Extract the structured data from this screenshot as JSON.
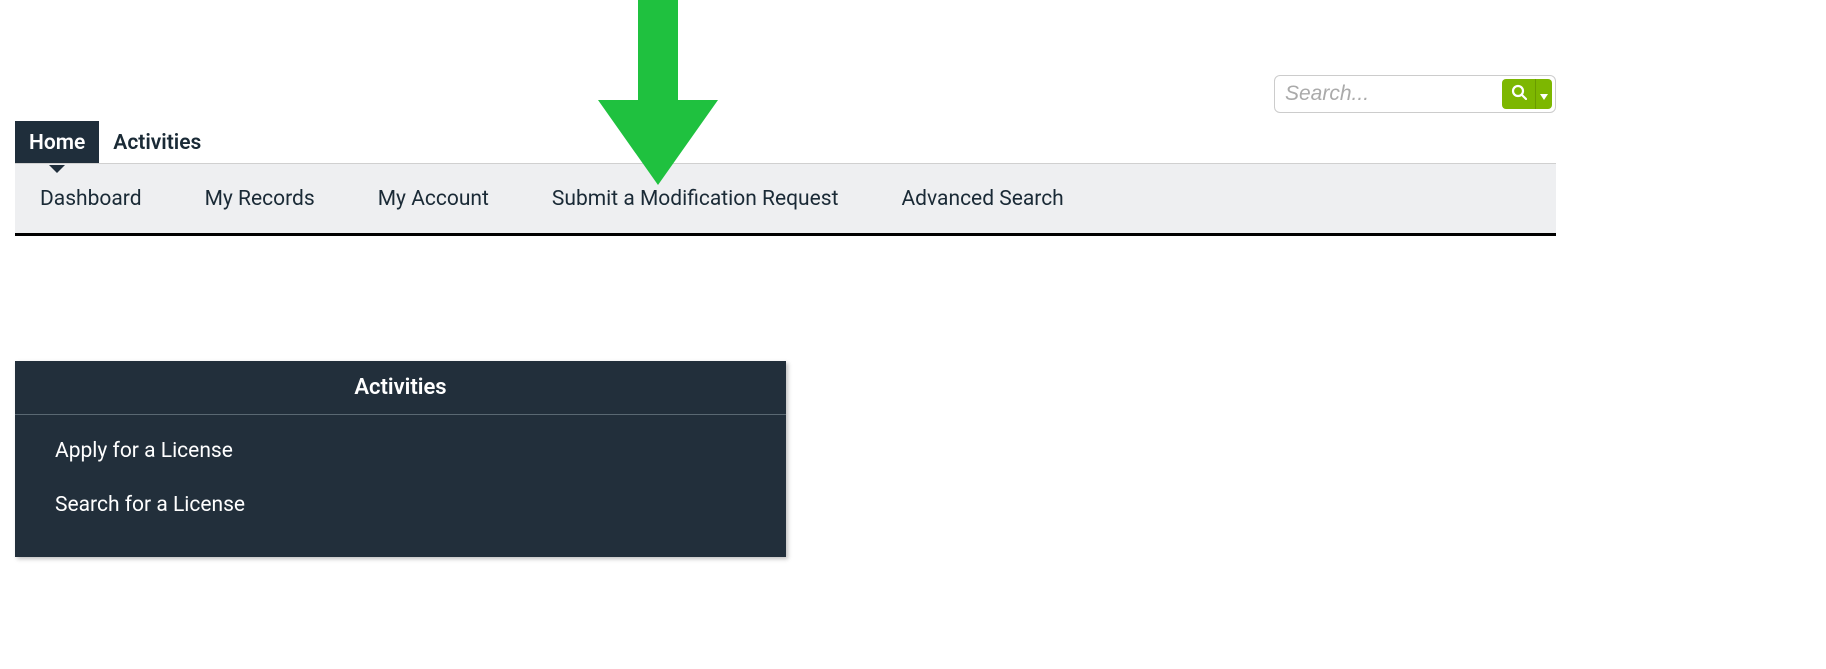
{
  "annotation": {
    "arrow_color": "#1fc13f"
  },
  "search": {
    "placeholder": "Search...",
    "button_color": "#7db701"
  },
  "top_tabs": [
    {
      "label": "Home",
      "active": true
    },
    {
      "label": "Activities",
      "active": false
    }
  ],
  "sub_nav": [
    {
      "label": "Dashboard"
    },
    {
      "label": "My Records"
    },
    {
      "label": "My Account"
    },
    {
      "label": "Submit a Modification Request"
    },
    {
      "label": "Advanced Search"
    }
  ],
  "activities_panel": {
    "title": "Activities",
    "items": [
      {
        "label": "Apply for a License"
      },
      {
        "label": "Search for a License"
      }
    ]
  }
}
